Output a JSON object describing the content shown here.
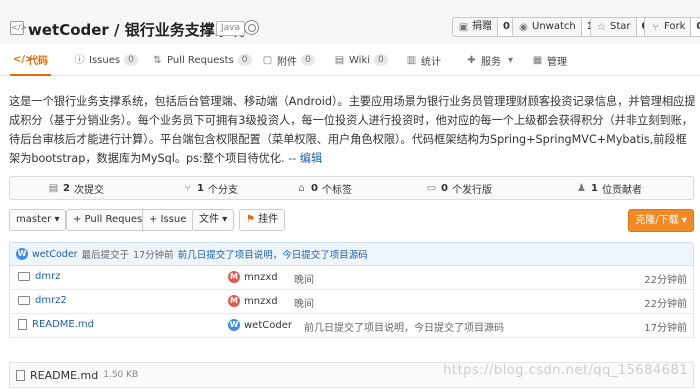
{
  "repo": {
    "owner_name": "wetCoder / 银行业务支撑系统",
    "language": "Java"
  },
  "topbar": {
    "donate_label": "捐赠",
    "donate_count": "0",
    "unwatch_label": "Unwatch",
    "watch_count": "1",
    "star_label": "Star",
    "star_count": "0",
    "fork_label": "Fork",
    "fork_count": "0"
  },
  "tabs": [
    {
      "label": "代码"
    },
    {
      "label": "Issues",
      "count": "0"
    },
    {
      "label": "Pull Requests",
      "count": "0"
    },
    {
      "label": "附件",
      "count": "0"
    },
    {
      "label": "Wiki",
      "count": "0"
    },
    {
      "label": "统计"
    },
    {
      "label": "服务"
    },
    {
      "label": "管理"
    }
  ],
  "description": {
    "text": "这是一个银行业务支撑系统，包括后台管理端、移动端（Android）。主要应用场景为银行业务员管理理财顾客投资记录信息，并管理相应提成积分（基于分销业务）。每个业务员下可拥有3级投资人，每一位投资人进行投资时，他对应的每一个上级都会获得积分（并非立刻到账，待后台审核后才能进行计算）。平台端包含权限配置（菜单权限、用户角色权限）。代码框架结构为Spring+SpringMVC+Mybatis,前段框架为bootstrap，数据库为MySql。ps:整个项目待优化.",
    "edit_link": "-- 编辑"
  },
  "stats": {
    "commits_num": "2",
    "commits_label": "次提交",
    "branches_num": "1",
    "branches_label": "个分支",
    "tags_num": "0",
    "tags_label": "个标签",
    "releases_num": "0",
    "releases_label": "个发行版",
    "contributors_num": "1",
    "contributors_label": "位贡献者"
  },
  "actions": {
    "branch": "master",
    "pull_request": "+ Pull Request",
    "issue": "+ Issue",
    "files": "文件",
    "pendant": "挂件",
    "clone": "克隆/下载"
  },
  "last_commit": {
    "avatar_letter": "W",
    "author": "wetCoder",
    "text": "最后提交于",
    "time": "17分钟前",
    "message": "前几日提交了项目说明，今日提交了项目源码"
  },
  "files": [
    {
      "name": "dmrz",
      "type": "folder",
      "avatar": "M",
      "author": "mnzxd",
      "message": "晚间",
      "time": "22分钟前"
    },
    {
      "name": "dmrz2",
      "type": "folder",
      "avatar": "M",
      "author": "mnzxd",
      "message": "晚间",
      "time": "22分钟前"
    },
    {
      "name": "README.md",
      "type": "file",
      "avatar": "W",
      "author": "wetCoder",
      "message": "前几日提交了项目说明，今日提交了项目源码",
      "time": "17分钟前"
    }
  ],
  "readme": {
    "name": "README.md",
    "size": "1.50 KB"
  },
  "watermark": "https://blog.csdn.net/qq_15684681"
}
